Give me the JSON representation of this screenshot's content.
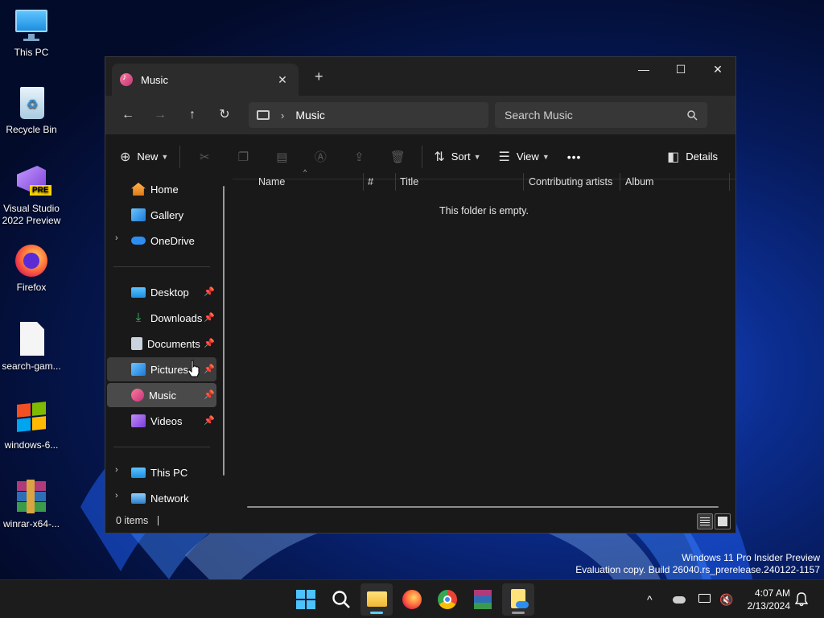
{
  "desktop": {
    "icons": [
      {
        "label": "This PC"
      },
      {
        "label": "Recycle Bin"
      },
      {
        "label": "Visual Studio 2022 Preview",
        "badge": "PRE"
      },
      {
        "label": "Firefox"
      },
      {
        "label": "search-gam..."
      },
      {
        "label": "windows-6..."
      },
      {
        "label": "winrar-x64-..."
      }
    ]
  },
  "window": {
    "tab_title": "Music",
    "tab_close": "✕",
    "new_tab": "+",
    "controls": {
      "minimize": "—",
      "maximize": "☐",
      "close": "✕"
    },
    "nav": {
      "back": "←",
      "forward": "→",
      "up": "↑",
      "refresh": "↻"
    },
    "address": {
      "separator": "›",
      "location": "Music"
    },
    "search": {
      "placeholder": "Search Music"
    },
    "toolbar": {
      "new_label": "New",
      "sort_label": "Sort",
      "view_label": "View",
      "more": "•••",
      "details_label": "Details"
    },
    "sidebar": {
      "home": "Home",
      "gallery": "Gallery",
      "onedrive": "OneDrive",
      "desktop": "Desktop",
      "downloads": "Downloads",
      "documents": "Documents",
      "pictures": "Pictures",
      "music": "Music",
      "videos": "Videos",
      "this_pc": "This PC",
      "network": "Network"
    },
    "columns": [
      "Name",
      "#",
      "Title",
      "Contributing artists",
      "Album"
    ],
    "empty_message": "This folder is empty.",
    "status": {
      "items": "0 items"
    }
  },
  "watermark": {
    "line1": "Windows 11 Pro Insider Preview",
    "line2": "Evaluation copy. Build 26040.rs_prerelease.240122-1157"
  },
  "taskbar": {
    "time": "4:07 AM",
    "date": "2/13/2024"
  },
  "colors": {
    "accent": "#60cdff",
    "window_bg": "#191919",
    "taskbar_bg": "#1c1c1c"
  }
}
